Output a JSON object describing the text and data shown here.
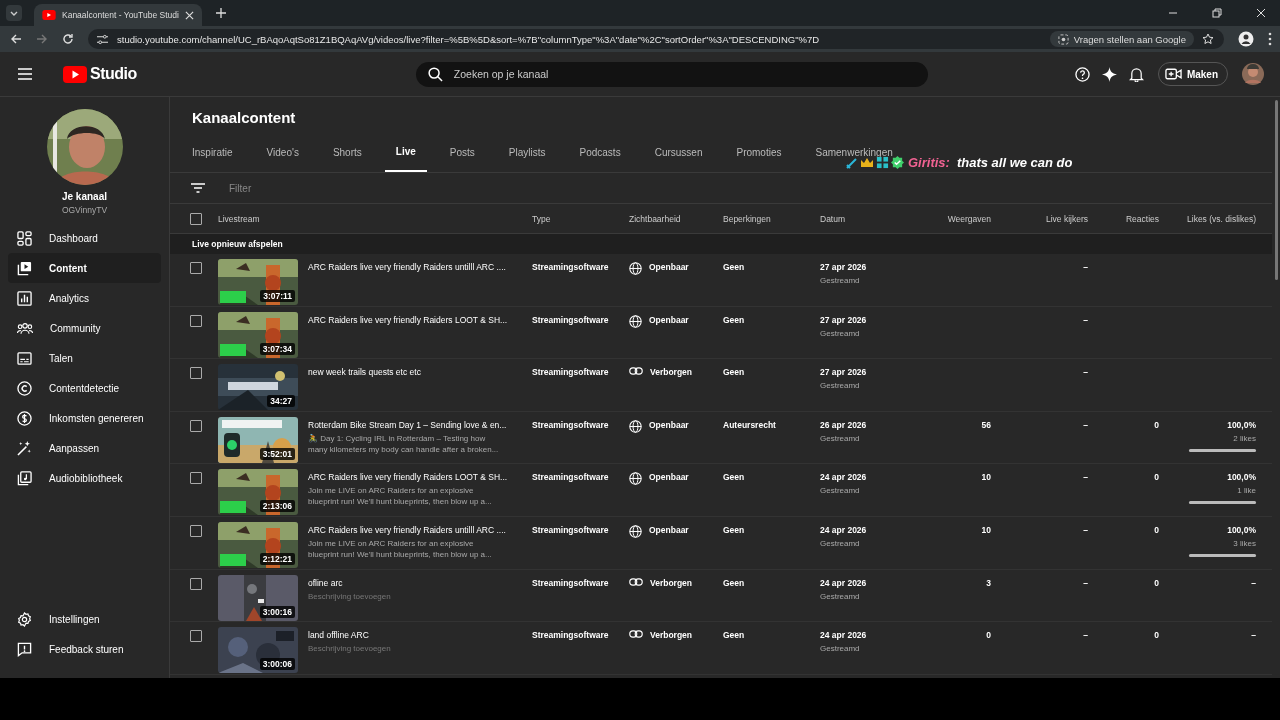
{
  "browser": {
    "tab_title": "Kanaalcontent - YouTube Studi",
    "url": "studio.youtube.com/channel/UC_rBAqoAqtSo81Z1BQAqAVg/videos/live?filter=%5B%5D&sort=%7B\"columnType\"%3A\"date\"%2C\"sortOrder\"%3A\"DESCENDING\"%7D",
    "ask_button": "Vragen stellen aan Google"
  },
  "header": {
    "logo": "Studio",
    "search": {
      "placeholder": "Zoeken op je kanaal"
    },
    "create_button": "Maken"
  },
  "sidebar": {
    "channel_label": "Je kanaal",
    "channel_name": "OGVinnyTV",
    "items": [
      {
        "label": "Dashboard",
        "selected": false
      },
      {
        "label": "Content",
        "selected": true
      },
      {
        "label": "Analytics",
        "selected": false
      },
      {
        "label": "Community",
        "selected": false
      },
      {
        "label": "Talen",
        "selected": false
      },
      {
        "label": "Contentdetectie",
        "selected": false
      },
      {
        "label": "Inkomsten genereren",
        "selected": false
      },
      {
        "label": "Aanpassen",
        "selected": false
      },
      {
        "label": "Audiobibliotheek",
        "selected": false
      }
    ],
    "footer_items": [
      {
        "label": "Instellingen"
      },
      {
        "label": "Feedback sturen"
      }
    ]
  },
  "page": {
    "title": "Kanaalcontent",
    "tabs": [
      {
        "label": "Inspiratie",
        "selected": false
      },
      {
        "label": "Video's",
        "selected": false
      },
      {
        "label": "Shorts",
        "selected": false
      },
      {
        "label": "Live",
        "selected": true
      },
      {
        "label": "Posts",
        "selected": false
      },
      {
        "label": "Playlists",
        "selected": false
      },
      {
        "label": "Podcasts",
        "selected": false
      },
      {
        "label": "Cursussen",
        "selected": false
      },
      {
        "label": "Promoties",
        "selected": false
      },
      {
        "label": "Samenwerkingen",
        "selected": false
      }
    ],
    "chat_overlay": {
      "user": "Giritis:",
      "message": "thats all we can do"
    },
    "filter": {
      "placeholder": "Filter"
    }
  },
  "table": {
    "columns": [
      "Livestream",
      "Type",
      "Zichtbaarheid",
      "Beperkingen",
      "Datum",
      "Weergaven",
      "Live kijkers",
      "Reacties",
      "Likes (vs. dislikes)"
    ],
    "select_all_checked": false,
    "section": "Live opnieuw afspelen",
    "rows": [
      {
        "checked": false,
        "duration": "3:07:11",
        "title": "ARC Raiders live very friendly Raiders untilll ARC ....",
        "type": "Streamingsoftware",
        "visibility": {
          "kind": "public",
          "label": "Openbaar"
        },
        "restrictions": "Geen",
        "date": "27 apr 2026",
        "status": "Gestreamd",
        "live_viewers": "–"
      },
      {
        "checked": false,
        "duration": "3:07:34",
        "title": "ARC Raiders live very friendly Raiders LOOT & SH...",
        "type": "Streamingsoftware",
        "visibility": {
          "kind": "public",
          "label": "Openbaar"
        },
        "restrictions": "Geen",
        "date": "27 apr 2026",
        "status": "Gestreamd",
        "live_viewers": "–"
      },
      {
        "checked": false,
        "duration": "34:27",
        "title": "new week trails quests etc etc",
        "type": "Streamingsoftware",
        "visibility": {
          "kind": "unlisted",
          "label": "Verborgen"
        },
        "restrictions": "Geen",
        "date": "27 apr 2026",
        "status": "Gestreamd",
        "live_viewers": "–"
      },
      {
        "checked": false,
        "duration": "3:52:01",
        "title": "Rotterdam Bike Stream Day 1 – Sending love & en...",
        "description": "🚴 Day 1: Cycling IRL in Rotterdam – Testing how many kilometers my body can handle after a broken...",
        "type": "Streamingsoftware",
        "visibility": {
          "kind": "public",
          "label": "Openbaar"
        },
        "restrictions": "Auteursrecht",
        "date": "26 apr 2026",
        "status": "Gestreamd",
        "views": "56",
        "live_viewers": "–",
        "comments": "0",
        "likes": {
          "value": "100,0%",
          "count": "2 likes",
          "level": 1
        }
      },
      {
        "checked": false,
        "duration": "2:13:06",
        "title": "ARC Raiders live very friendly Raiders LOOT & SH...",
        "description": "Join me LIVE on ARC Raiders for an explosive blueprint run! We'll hunt blueprints, then blow up a...",
        "type": "Streamingsoftware",
        "visibility": {
          "kind": "public",
          "label": "Openbaar"
        },
        "restrictions": "Geen",
        "date": "24 apr 2026",
        "status": "Gestreamd",
        "views": "10",
        "live_viewers": "–",
        "comments": "0",
        "likes": {
          "value": "100,0%",
          "count": "1 like",
          "level": 1
        }
      },
      {
        "checked": false,
        "duration": "2:12:21",
        "title": "ARC Raiders live very friendly Raiders untilll ARC ....",
        "description": "Join me LIVE on ARC Raiders for an explosive blueprint run! We'll hunt blueprints, then blow up a...",
        "type": "Streamingsoftware",
        "visibility": {
          "kind": "public",
          "label": "Openbaar"
        },
        "restrictions": "Geen",
        "date": "24 apr 2026",
        "status": "Gestreamd",
        "views": "10",
        "live_viewers": "–",
        "comments": "0",
        "likes": {
          "value": "100,0%",
          "count": "3 likes",
          "level": 1
        }
      },
      {
        "checked": false,
        "duration": "3:00:16",
        "title": "ofline arc",
        "description": "Beschrijving toevoegen",
        "description_placeholder": true,
        "type": "Streamingsoftware",
        "visibility": {
          "kind": "unlisted",
          "label": "Verborgen"
        },
        "restrictions": "Geen",
        "date": "24 apr 2026",
        "status": "Gestreamd",
        "views": "3",
        "live_viewers": "–",
        "comments": "0",
        "likes": {
          "value": "–"
        }
      },
      {
        "checked": false,
        "duration": "3:00:06",
        "title": "land offline ARC",
        "description": "Beschrijving toevoegen",
        "description_placeholder": true,
        "type": "Streamingsoftware",
        "visibility": {
          "kind": "unlisted",
          "label": "Verborgen"
        },
        "restrictions": "Geen",
        "date": "24 apr 2026",
        "status": "Gestreamd",
        "views": "0",
        "live_viewers": "–",
        "comments": "0",
        "likes": {
          "value": "–"
        }
      }
    ]
  }
}
